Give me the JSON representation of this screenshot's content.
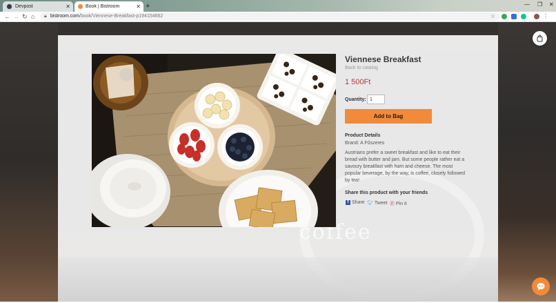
{
  "browser": {
    "tabs": [
      {
        "title": "Devpost",
        "active": false
      },
      {
        "title": "Book | Bistroom",
        "active": true
      }
    ],
    "new_tab_glyph": "+",
    "url_host": "bistroom.com",
    "url_path": "/book/Viennese-Breakfast-p194154662"
  },
  "product": {
    "title": "Viennese Breakfast",
    "back_link": "Back to catalog",
    "price": "1 500Ft",
    "quantity_label": "Quantity:",
    "quantity_value": "1",
    "add_button": "Add to Bag",
    "details_heading": "Product Details",
    "brand": "Brand: A Fűszeres",
    "description": "Austrians prefer a sweet breakfast and like to eat their bread with butter and jam. But some people rather eat a savoury breakfast with ham and cheese. The most popular beverage, by the way, is coffee, closely followed by tea!",
    "share_heading": "Share this product with your friends",
    "share_links": {
      "facebook": "Share",
      "twitter": "Tweet",
      "pinterest": "Pin it"
    }
  },
  "background_text": "coffee",
  "colors": {
    "accent": "#f28a3c",
    "price": "#b33a2e"
  }
}
